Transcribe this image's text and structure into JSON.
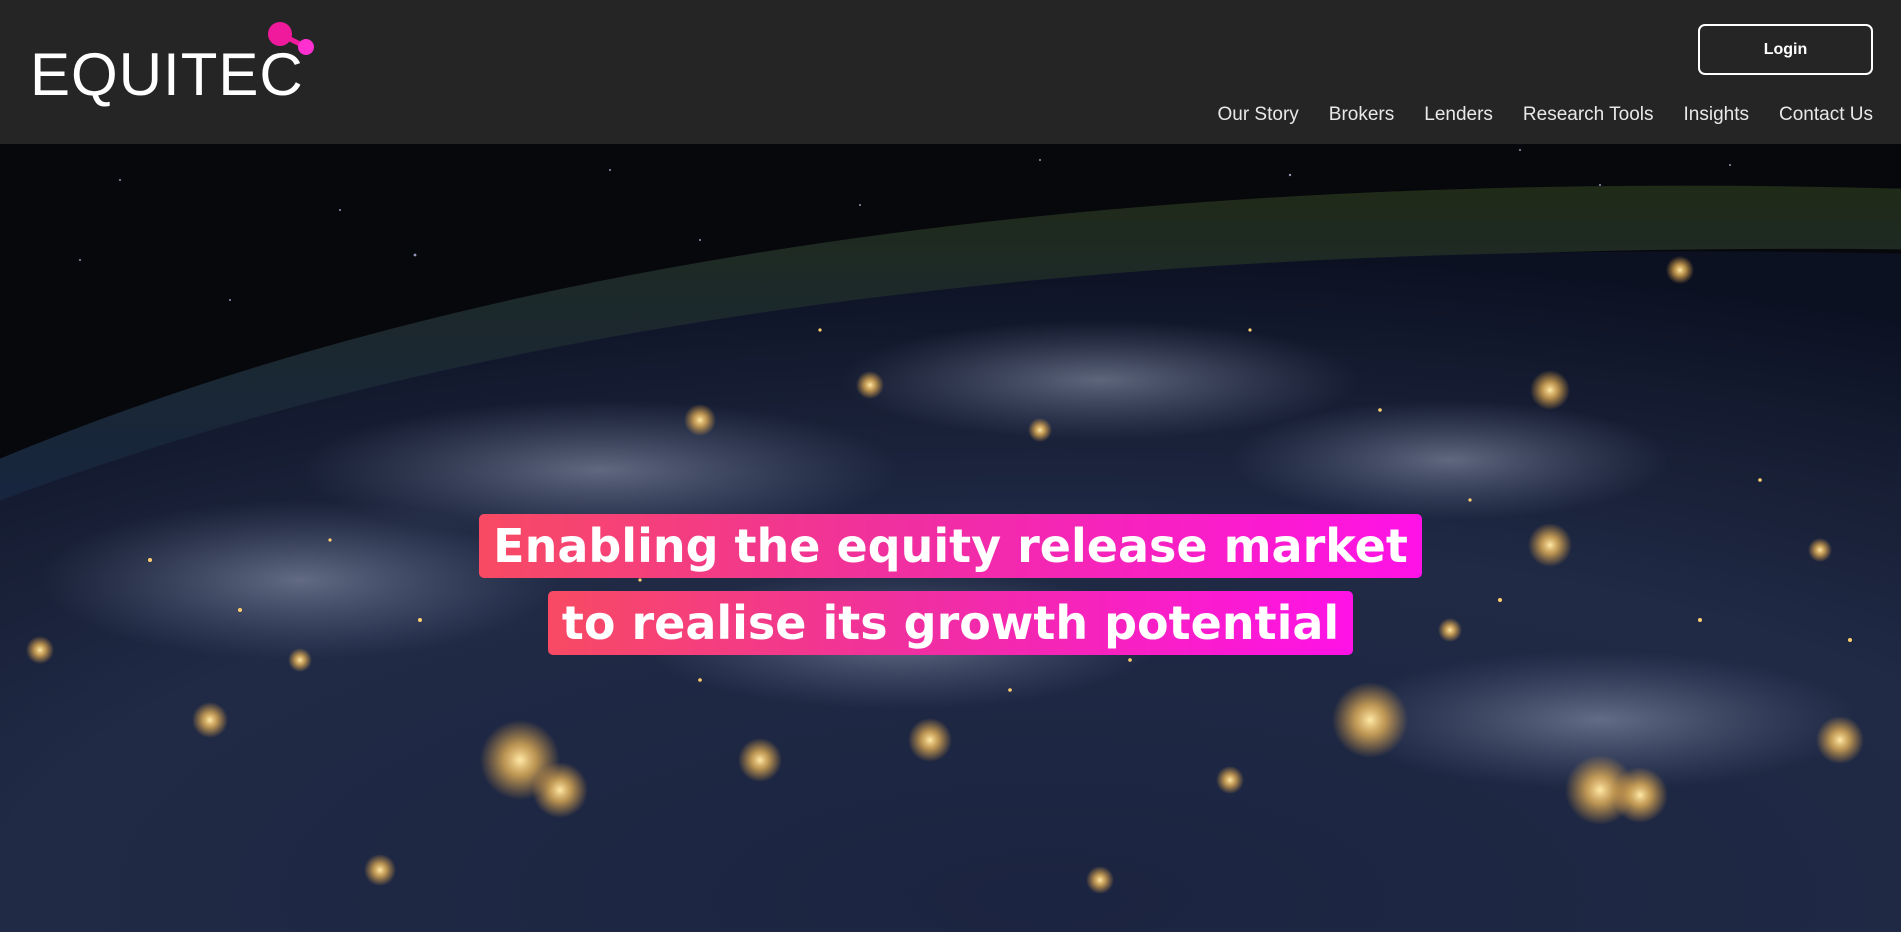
{
  "brand": {
    "name": "EQUITEC",
    "accent_color": "#f01b9c",
    "secondary_accent": "#ff2fd0"
  },
  "header": {
    "login_label": "Login",
    "nav": [
      {
        "label": "Our Story"
      },
      {
        "label": "Brokers"
      },
      {
        "label": "Lenders"
      },
      {
        "label": "Research Tools"
      },
      {
        "label": "Insights"
      },
      {
        "label": "Contact Us"
      }
    ]
  },
  "hero": {
    "headline_lines": [
      "Enabling the equity release market",
      "to realise its growth potential"
    ],
    "background": "night-earth-from-space-image",
    "gradient": [
      "#f84a63",
      "#ff12e6"
    ]
  }
}
